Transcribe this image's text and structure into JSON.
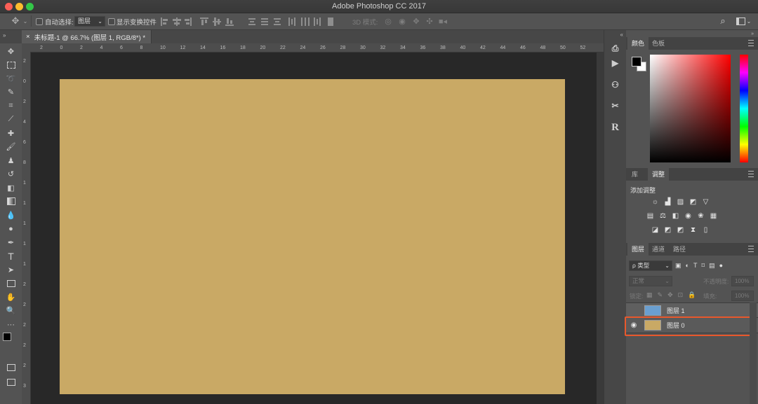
{
  "app_title": "Adobe Photoshop CC 2017",
  "window_lights": {
    "close": "#fc5f57",
    "minimize": "#fdbc2e",
    "zoom": "#33c748"
  },
  "options_bar": {
    "move_icon": "move-tool-icon",
    "auto_select_label": "自动选择:",
    "auto_select_value": "图层",
    "show_transform_label": "显示变换控件",
    "mode_3d_label": "3D 模式:"
  },
  "document_tab": {
    "close_glyph": "×",
    "title": "未标题-1 @ 66.7% (图层 1, RGB/8*) *"
  },
  "ruler_h_labels": [
    "2",
    "0",
    "2",
    "4",
    "6",
    "8",
    "10",
    "12",
    "14",
    "16",
    "18",
    "20",
    "22",
    "24",
    "26",
    "28",
    "30",
    "32",
    "34",
    "36",
    "38",
    "40",
    "42",
    "44",
    "46",
    "48",
    "50",
    "52"
  ],
  "ruler_v_labels": [
    "2",
    "0",
    "2",
    "4",
    "6",
    "8",
    "1",
    "1",
    "1",
    "1",
    "1",
    "2",
    "2",
    "2",
    "2",
    "2",
    "3"
  ],
  "canvas_color": "#c9a965",
  "color_panel": {
    "tabs": [
      "颜色",
      "色板"
    ],
    "foreground": "#000000",
    "background": "#ffffff",
    "hue_color": "#ff0000"
  },
  "adjustments_panel": {
    "tabs": [
      "库",
      "调整"
    ],
    "add_label": "添加调整"
  },
  "layers_panel": {
    "tabs": [
      "图层",
      "通道",
      "路径"
    ],
    "filter_label": "ρ 类型",
    "blend_mode": "正常",
    "opacity_label": "不透明度:",
    "opacity_value": "100%",
    "lock_label": "锁定:",
    "fill_label": "填充:",
    "fill_value": "100%",
    "layers": [
      {
        "name": "图层 1",
        "color": "#6a9fd0",
        "visible": false
      },
      {
        "name": "图层 0",
        "color": "#c9a965",
        "visible": true,
        "highlighted": true
      }
    ],
    "highlight_color": "#e8582c"
  }
}
